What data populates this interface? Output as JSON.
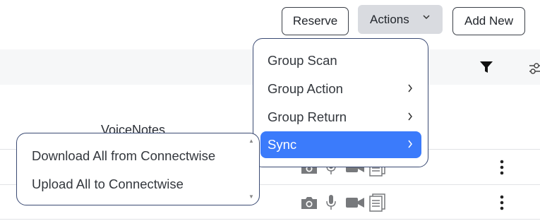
{
  "toolbar": {
    "reserve_label": "Reserve",
    "actions_label": "Actions",
    "add_new_label": "Add New"
  },
  "table": {
    "voicenotes_header": "VoiceNotes",
    "header_icons": [
      "filter-icon",
      "column-settings-icon"
    ],
    "row_icons": [
      "camera-icon",
      "microphone-icon",
      "video-icon",
      "document-icon",
      "kebab-menu-icon"
    ]
  },
  "actions_menu": {
    "items": [
      {
        "label": "Group Scan",
        "has_submenu": false
      },
      {
        "label": "Group Action",
        "has_submenu": true
      },
      {
        "label": "Group Return",
        "has_submenu": true
      },
      {
        "label": "Sync",
        "has_submenu": true,
        "active": true
      }
    ]
  },
  "sync_menu": {
    "items": [
      {
        "label": "Download All from Connectwise"
      },
      {
        "label": "Upload All to Connectwise"
      }
    ]
  },
  "colors": {
    "active_item": "#3b7bfb",
    "actions_button_bg": "#d9dbe0",
    "menu_border": "#3a4a73",
    "row_icon": "#77797c"
  }
}
